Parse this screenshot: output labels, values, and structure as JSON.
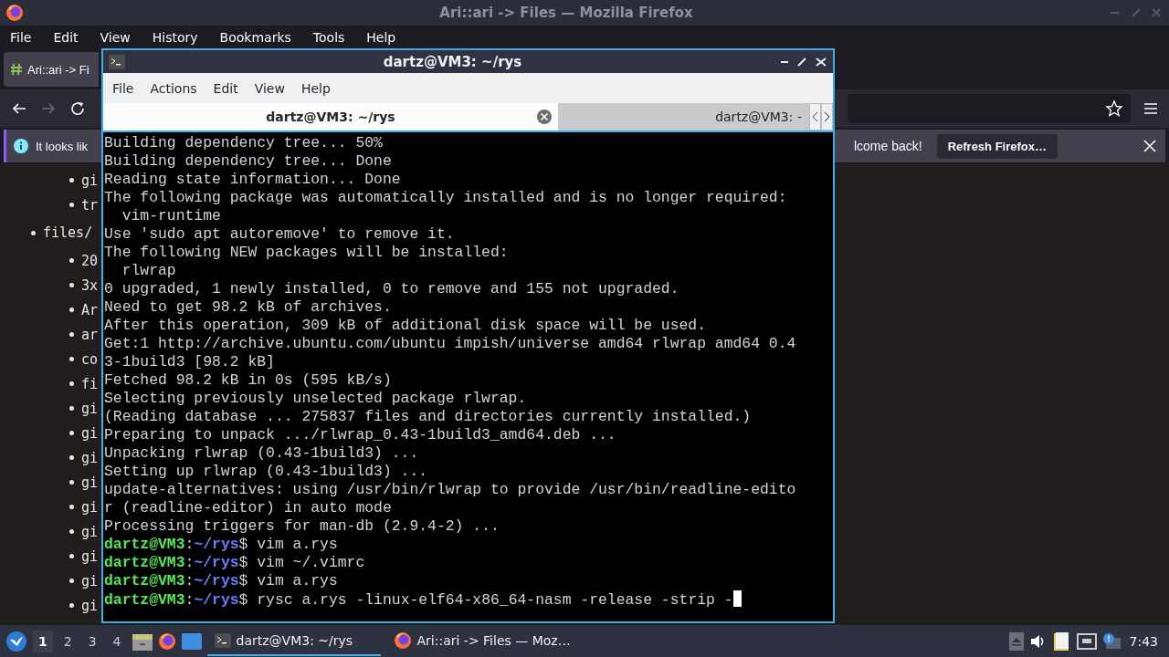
{
  "firefox": {
    "title": "Ari::ari -> Files — Mozilla Firefox",
    "menu": [
      "File",
      "Edit",
      "View",
      "History",
      "Bookmarks",
      "Tools",
      "Help"
    ],
    "tab": {
      "title": "Ari::ari -> Fi"
    },
    "nav": {
      "forward_disabled": true
    },
    "notification": {
      "text_start": "It looks lik",
      "text_end": "lcome back!",
      "button": "Refresh Firefox…"
    },
    "page": {
      "list": [
        {
          "children": [
            {
              "text": "gi"
            },
            {
              "text": "tr"
            }
          ]
        },
        {
          "text": "files/",
          "children": [
            {
              "text": "20"
            },
            {
              "text": "3x"
            },
            {
              "text": "Ar"
            },
            {
              "text": "ar"
            },
            {
              "text": "co"
            },
            {
              "text": "fi"
            },
            {
              "text": "gi"
            },
            {
              "text": "gi"
            },
            {
              "text": "gi"
            },
            {
              "text": "gi"
            },
            {
              "text": "gi"
            },
            {
              "text": "gi"
            },
            {
              "text": "gi"
            },
            {
              "text": "gi"
            },
            {
              "text": "gi"
            }
          ]
        }
      ]
    }
  },
  "terminal": {
    "title": "dartz@VM3: ~/rys",
    "menu": [
      "File",
      "Actions",
      "Edit",
      "View",
      "Help"
    ],
    "tabs": [
      {
        "label": "dartz@VM3: ~/rys",
        "selected": true
      },
      {
        "label": "dartz@VM3: -",
        "selected": false
      }
    ],
    "lines": [
      {
        "kind": "output",
        "text": "Building dependency tree... 50%"
      },
      {
        "kind": "output",
        "text": "Building dependency tree... Done"
      },
      {
        "kind": "output",
        "text": "Reading state information... Done"
      },
      {
        "kind": "output",
        "text": "The following package was automatically installed and is no longer required:"
      },
      {
        "kind": "output",
        "text": "  vim-runtime"
      },
      {
        "kind": "output",
        "text": "Use 'sudo apt autoremove' to remove it."
      },
      {
        "kind": "output",
        "text": "The following NEW packages will be installed:"
      },
      {
        "kind": "output",
        "text": "  rlwrap"
      },
      {
        "kind": "output",
        "text": "0 upgraded, 1 newly installed, 0 to remove and 155 not upgraded."
      },
      {
        "kind": "output",
        "text": "Need to get 98.2 kB of archives."
      },
      {
        "kind": "output",
        "text": "After this operation, 309 kB of additional disk space will be used."
      },
      {
        "kind": "output",
        "text": "Get:1 http://archive.ubuntu.com/ubuntu impish/universe amd64 rlwrap amd64 0.4"
      },
      {
        "kind": "output",
        "text": "3-1build3 [98.2 kB]"
      },
      {
        "kind": "output",
        "text": "Fetched 98.2 kB in 0s (595 kB/s)"
      },
      {
        "kind": "output",
        "text": "Selecting previously unselected package rlwrap."
      },
      {
        "kind": "output",
        "text": "(Reading database ... 275837 files and directories currently installed.)"
      },
      {
        "kind": "output",
        "text": "Preparing to unpack .../rlwrap_0.43-1build3_amd64.deb ..."
      },
      {
        "kind": "output",
        "text": "Unpacking rlwrap (0.43-1build3) ..."
      },
      {
        "kind": "output",
        "text": "Setting up rlwrap (0.43-1build3) ..."
      },
      {
        "kind": "output",
        "text": "update-alternatives: using /usr/bin/rlwrap to provide /usr/bin/readline-edito"
      },
      {
        "kind": "output",
        "text": "r (readline-editor) in auto mode"
      },
      {
        "kind": "output",
        "text": "Processing triggers for man-db (2.9.4-2) ..."
      },
      {
        "kind": "prompt",
        "user": "dartz@VM3",
        "sep": ":",
        "path": "~/rys",
        "sign": "$",
        "command": "vim a.rys",
        "cursor": false
      },
      {
        "kind": "prompt",
        "user": "dartz@VM3",
        "sep": ":",
        "path": "~/rys",
        "sign": "$",
        "command": "vim ~/.vimrc",
        "cursor": false
      },
      {
        "kind": "prompt",
        "user": "dartz@VM3",
        "sep": ":",
        "path": "~/rys",
        "sign": "$",
        "command": "vim a.rys",
        "cursor": false
      },
      {
        "kind": "prompt",
        "user": "dartz@VM3",
        "sep": ":",
        "path": "~/rys",
        "sign": "$",
        "command": "rysc a.rys -linux-elf64-x86_64-nasm -release -strip -",
        "cursor": true
      }
    ]
  },
  "taskbar": {
    "workspaces": [
      {
        "label": "1",
        "selected": true
      },
      {
        "label": "2",
        "selected": false
      },
      {
        "label": "3",
        "selected": false
      },
      {
        "label": "4",
        "selected": false
      }
    ],
    "tasks": [
      {
        "label": "dartz@VM3: ~/rys",
        "kind": "terminal",
        "selected": true
      },
      {
        "label": "Ari::ari -> Files — Moz…",
        "kind": "browser",
        "selected": false
      }
    ],
    "clock": "7:43"
  }
}
